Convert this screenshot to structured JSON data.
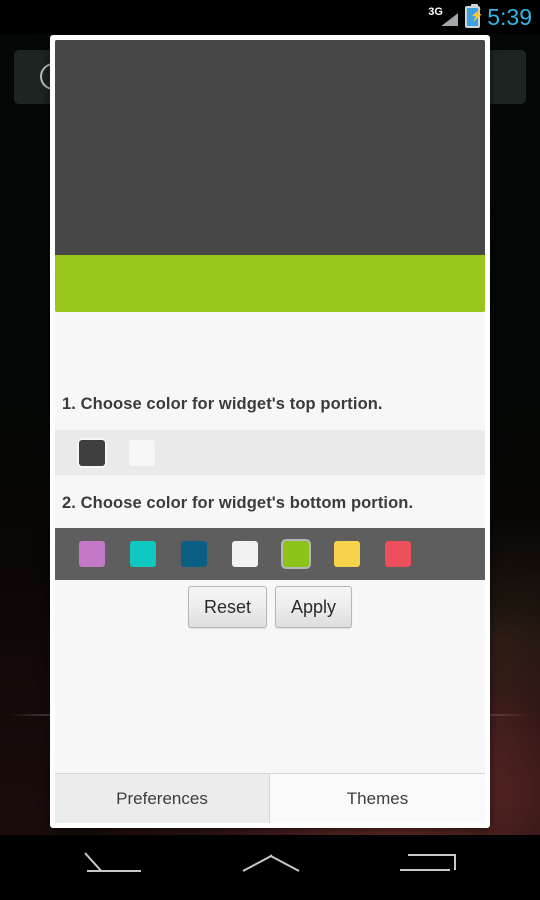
{
  "status_bar": {
    "network_label": "3G",
    "signal_icon": "signal-bars-icon",
    "battery_icon": "battery-charging-icon",
    "battery_bolt": "⚡",
    "time": "5:39"
  },
  "home_screen": {
    "search_widget": {
      "icon": "search-icon"
    }
  },
  "dialog": {
    "preview": {
      "top_color": "#464646",
      "bottom_color": "#9AC61C"
    },
    "sections": [
      {
        "label": "1. Choose color for widget's top portion.",
        "row_background": "#EAEAEA",
        "swatches": [
          {
            "name": "dark-gray",
            "color": "#3F3F3F",
            "selected": true
          },
          {
            "name": "white",
            "color": "#F7F7F7",
            "selected": false
          }
        ]
      },
      {
        "label": "2. Choose color for widget's bottom portion.",
        "row_background": "#5E5E5E",
        "swatches": [
          {
            "name": "purple",
            "color": "#C478C8",
            "selected": false
          },
          {
            "name": "teal",
            "color": "#0FC9C0",
            "selected": false
          },
          {
            "name": "dark-blue",
            "color": "#0A5F85",
            "selected": false
          },
          {
            "name": "white",
            "color": "#F2F2F2",
            "selected": false
          },
          {
            "name": "lime-green",
            "color": "#8CC31A",
            "selected": true
          },
          {
            "name": "yellow",
            "color": "#F7D24B",
            "selected": false
          },
          {
            "name": "red",
            "color": "#EE4F5C",
            "selected": false
          }
        ]
      }
    ],
    "buttons": {
      "reset_label": "Reset",
      "apply_label": "Apply"
    },
    "tabs": [
      {
        "label": "Preferences",
        "active": false
      },
      {
        "label": "Themes",
        "active": true
      }
    ]
  },
  "nav_bar": {
    "back_icon": "back-arrow-icon",
    "home_icon": "home-chevron-icon",
    "recents_icon": "recents-icon"
  }
}
